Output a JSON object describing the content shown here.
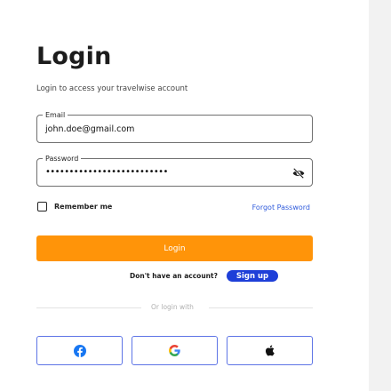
{
  "header": {
    "title": "Login",
    "subtitle": "Login to access your travelwise  account"
  },
  "form": {
    "email": {
      "label": "Email",
      "value": "john.doe@gmail.com"
    },
    "password": {
      "label": "Password",
      "value": "••••••••••••••••••••••••••"
    },
    "remember_label": "Remember me",
    "forgot_label": "Forgot Password",
    "login_label": "Login"
  },
  "signup": {
    "prompt": "Don't have an account?",
    "button_label": "Sign up"
  },
  "divider": {
    "text": "Or login with"
  },
  "social": {
    "icons": [
      "facebook-icon",
      "google-icon",
      "apple-icon"
    ]
  },
  "colors": {
    "primary": "#ff9409",
    "link": "#2f5bdc",
    "signup_bg": "#1e3fd8",
    "social_border": "#5d74e6",
    "facebook": "#1877f2"
  }
}
